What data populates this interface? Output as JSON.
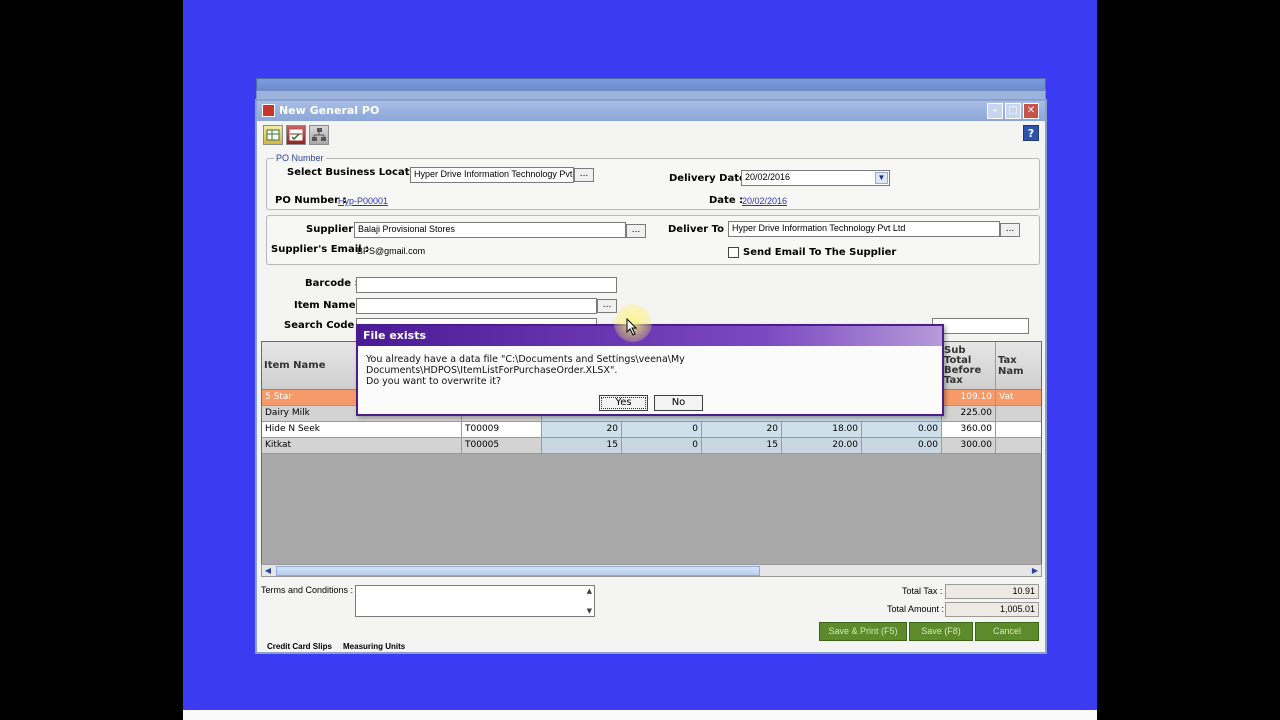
{
  "colors": {
    "desktop": "#3b3bf2",
    "selected_row": "#f79a6a",
    "button_green": "#5d8a2b",
    "dialog_title": "#4b1a96"
  },
  "window": {
    "title": "New General PO",
    "help_label": "?"
  },
  "toolbar": {
    "icons": [
      "grid-icon",
      "grid-check-icon",
      "hierarchy-icon"
    ]
  },
  "po_group": {
    "legend": "PO Number",
    "location_label": "Select Business Location :",
    "location_value": "Hyper Drive Information Technology Pvt L",
    "po_number_label": "PO Number :",
    "po_number_value": "Hyp-P00001",
    "delivery_date_label": "Delivery Date :",
    "delivery_date_value": "20/02/2016",
    "date_label": "Date :",
    "date_value": "20/02/2016"
  },
  "supplier_group": {
    "supplier_label": "Supplier :",
    "supplier_value": "Balaji Provisional Stores",
    "email_label": "Supplier's Email :",
    "email_value": "BPS@gmail.com",
    "deliver_to_label": "Deliver To :",
    "deliver_to_value": "Hyper Drive Information Technology Pvt Ltd",
    "send_email_label": "Send Email To The Supplier"
  },
  "search": {
    "barcode_label": "Barcode :",
    "item_name_label": "Item Name :",
    "search_code_label": "Search Code :",
    "dots": "..."
  },
  "grid": {
    "headers": {
      "item_name": "Item Name",
      "sub_total": "Sub Total Before Tax",
      "tax_name": "Tax Nam"
    },
    "rows": [
      {
        "name": "5 Star",
        "code": "",
        "c1": "",
        "c2": "",
        "c3": "",
        "c4": "",
        "c5": "",
        "sub": "109.10",
        "tax": "Vat"
      },
      {
        "name": "Dairy Milk",
        "code": "",
        "c1": "",
        "c2": "",
        "c3": "",
        "c4": "",
        "c5": "",
        "sub": "225.00",
        "tax": ""
      },
      {
        "name": "Hide N Seek",
        "code": "T00009",
        "c1": "20",
        "c2": "0",
        "c3": "20",
        "c4": "18.00",
        "c5": "0.00",
        "sub": "360.00",
        "tax": ""
      },
      {
        "name": "Kitkat",
        "code": "T00005",
        "c1": "15",
        "c2": "0",
        "c3": "15",
        "c4": "20.00",
        "c5": "0.00",
        "sub": "300.00",
        "tax": ""
      }
    ]
  },
  "footer": {
    "terms_label": "Terms and Conditions :",
    "total_tax_label": "Total Tax :",
    "total_tax_value": "10.91",
    "total_amount_label": "Total Amount :",
    "total_amount_value": "1,005.01",
    "save_print_label": "Save & Print (F5)",
    "save_label": "Save (F8)",
    "cancel_label": "Cancel",
    "behind_text": "Credit Card Slips     Measuring Units"
  },
  "dialog": {
    "title": "File exists",
    "message": "You already have a data file \"C:\\Documents and Settings\\veena\\My Documents\\HDPOS\\ItemListForPurchaseOrder.XLSX\".\nDo you want to overwrite it?",
    "yes_label": "Yes",
    "no_label": "No"
  }
}
